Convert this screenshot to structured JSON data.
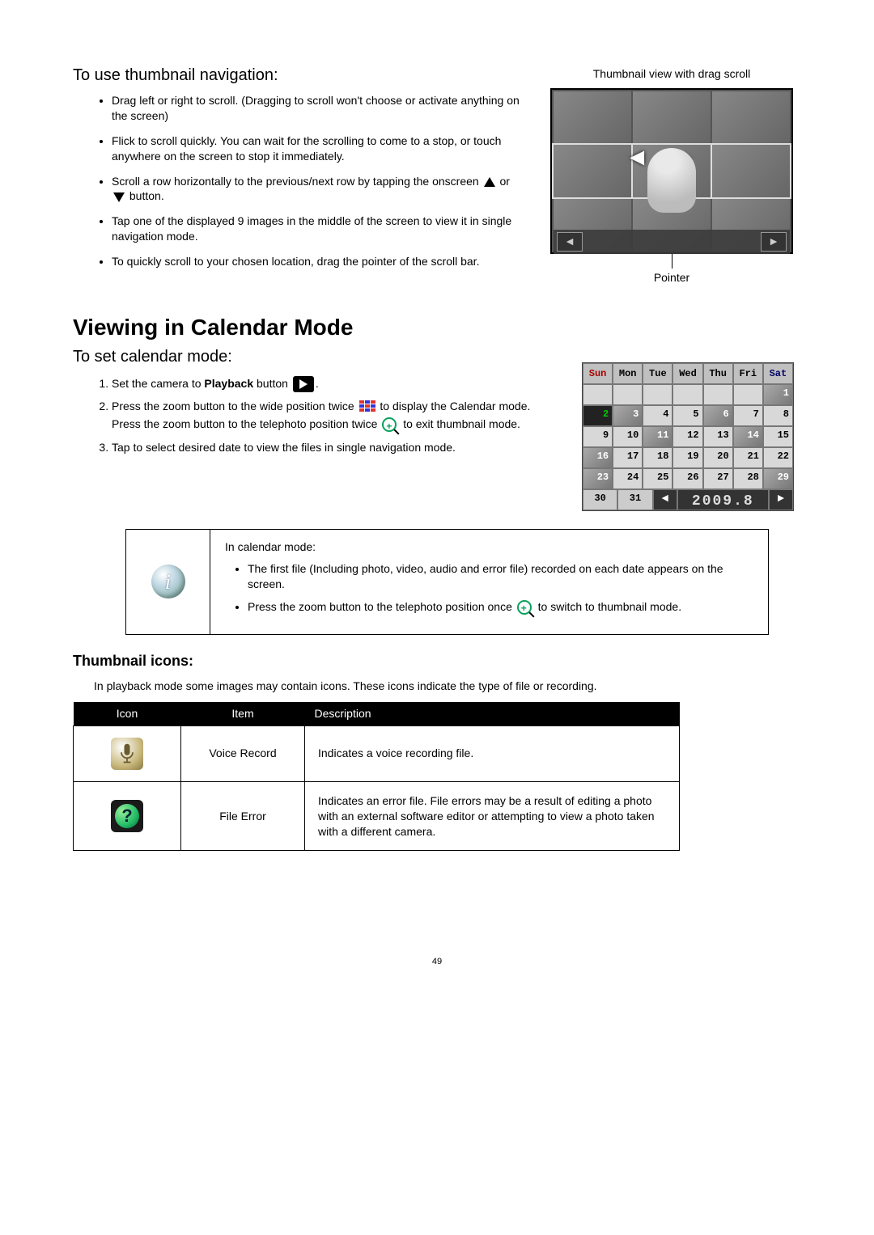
{
  "section1": {
    "heading": "To use thumbnail navigation:",
    "bullets": [
      "Drag left or right to scroll. (Dragging to scroll won't choose or activate anything on the screen)",
      "Flick to scroll quickly. You can wait for the scrolling to come to a stop, or touch anywhere on the screen to stop it immediately.",
      {
        "pre": "Scroll a row horizontally to the previous/next row by tapping the onscreen ",
        "mid": " or ",
        "post": " button."
      },
      "Tap one of the displayed 9 images in the middle of the screen to view it in single navigation mode.",
      "To quickly scroll to your chosen location, drag the pointer of the scroll bar."
    ],
    "caption_top": "Thumbnail view with drag scroll",
    "caption_pointer": "Pointer"
  },
  "section2": {
    "title": "Viewing in Calendar Mode",
    "subtitle": "To set calendar mode:",
    "steps": {
      "s1a": "Set the camera to ",
      "s1b": "Playback",
      "s1c": " button ",
      "s2a": "Press the zoom button to the wide position twice ",
      "s2b": " to display the Calendar mode.  Press the zoom button to the telephoto position twice ",
      "s2c": " to exit thumbnail mode.",
      "s3": "Tap to select desired date to view the files in single navigation mode."
    },
    "calendar": {
      "days": [
        "Sun",
        "Mon",
        "Tue",
        "Wed",
        "Thu",
        "Fri",
        "Sat"
      ],
      "cells": [
        "",
        "",
        "",
        "",
        "",
        "",
        "1",
        "2",
        "3",
        "4",
        "5",
        "6",
        "7",
        "8",
        "9",
        "10",
        "11",
        "12",
        "13",
        "14",
        "15",
        "16",
        "17",
        "18",
        "19",
        "20",
        "21",
        "22",
        "23",
        "24",
        "25",
        "26",
        "27",
        "28",
        "29"
      ],
      "photo_idx": [
        6,
        8,
        11,
        16,
        19,
        21,
        28,
        34
      ],
      "err_idx": [
        7
      ],
      "footer_left": [
        "30",
        "31"
      ],
      "ym": "2009.8"
    }
  },
  "infobox": {
    "lead": "In calendar mode:",
    "b1": "The first file (Including photo, video, audio and error file) recorded on each date appears on the screen.",
    "b2a": "Press the zoom button to the telephoto position once ",
    "b2b": " to switch to thumbnail mode."
  },
  "section3": {
    "heading": "Thumbnail icons:",
    "intro": "In playback mode some images may contain icons. These icons indicate the type of file or recording.",
    "headers": [
      "Icon",
      "Item",
      "Description"
    ],
    "rows": [
      {
        "item": "Voice Record",
        "desc": "Indicates a voice recording file."
      },
      {
        "item": "File Error",
        "desc": "Indicates an error file.  File errors may be a result of editing a photo with an external software editor or attempting to view a photo taken with a different camera."
      }
    ]
  },
  "page_number": "49"
}
